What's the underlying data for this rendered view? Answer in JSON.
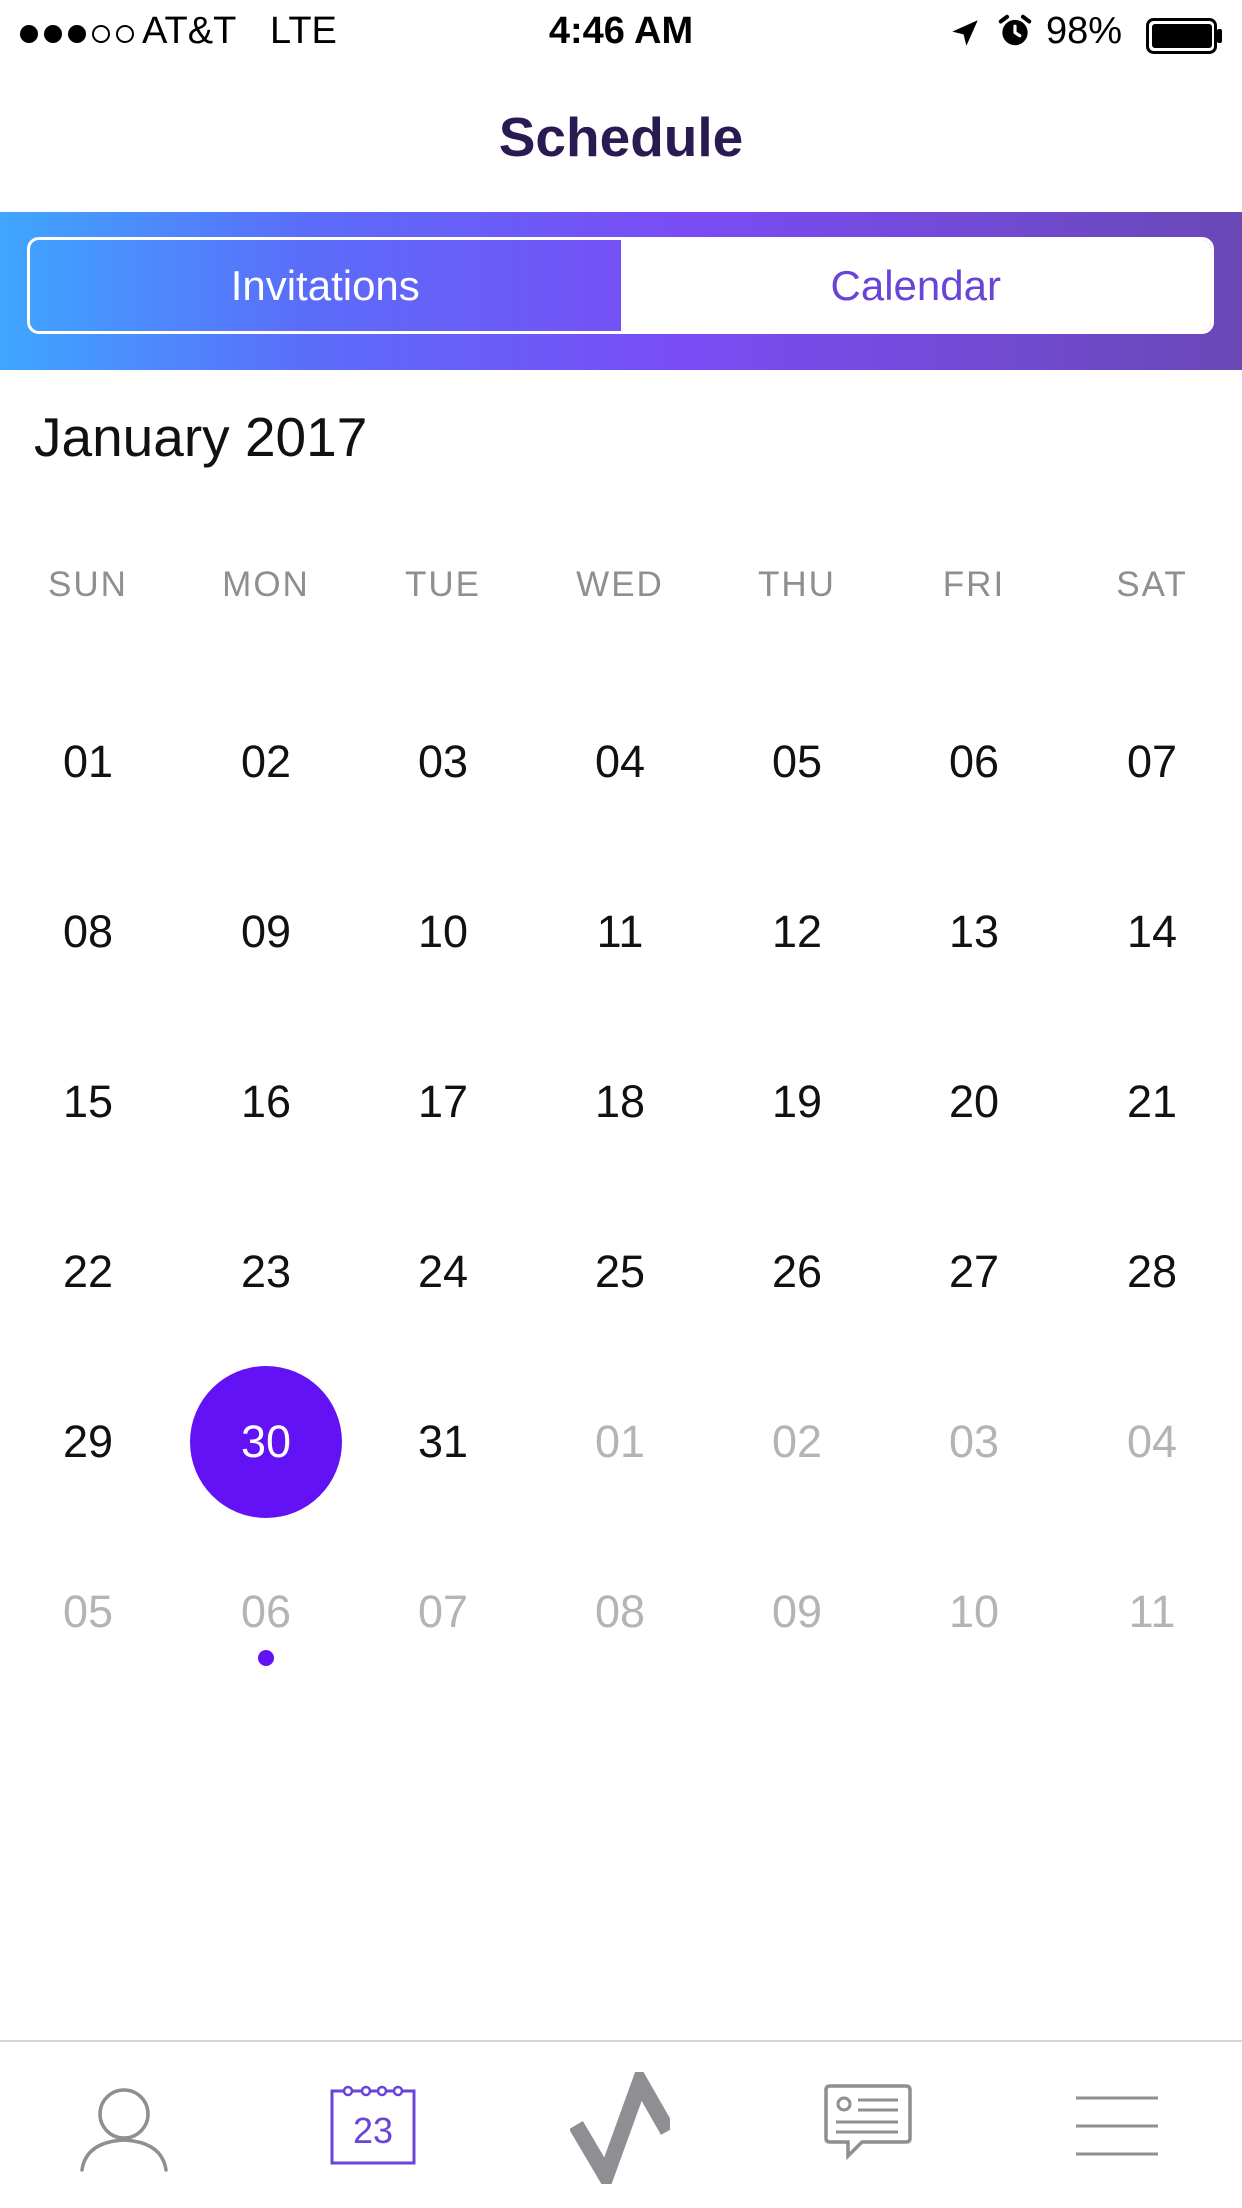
{
  "status_bar": {
    "carrier": "AT&T",
    "network": "LTE",
    "time": "4:46 AM",
    "battery": "98%",
    "signal_bars": 3,
    "signal_total": 5,
    "icons": [
      "location-arrow-icon",
      "alarm-clock-icon",
      "battery-icon"
    ]
  },
  "header": {
    "title": "Schedule"
  },
  "segmented_control": {
    "invitations_label": "Invitations",
    "calendar_label": "Calendar",
    "selected": "Calendar"
  },
  "calendar": {
    "month_label": "January 2017",
    "weekdays": [
      "SUN",
      "MON",
      "TUE",
      "WED",
      "THU",
      "FRI",
      "SAT"
    ],
    "weeks": [
      [
        "01",
        "02",
        "03",
        "04",
        "05",
        "06",
        "07"
      ],
      [
        "08",
        "09",
        "10",
        "11",
        "12",
        "13",
        "14"
      ],
      [
        "15",
        "16",
        "17",
        "18",
        "19",
        "20",
        "21"
      ],
      [
        "22",
        "23",
        "24",
        "25",
        "26",
        "27",
        "28"
      ],
      [
        "29",
        "30",
        "31",
        "01",
        "02",
        "03",
        "04"
      ],
      [
        "05",
        "06",
        "07",
        "08",
        "09",
        "10",
        "11"
      ]
    ],
    "selected_day": "30",
    "event_day": "06"
  },
  "tab_bar": {
    "calendar_icon_number": "23",
    "tabs": [
      "profile-icon",
      "calendar-icon",
      "activity-logo-icon",
      "messages-icon",
      "menu-icon"
    ],
    "active_tab": "calendar-icon"
  },
  "colors": {
    "accent": "#6212f5",
    "title": "#2a1a52",
    "segment_text": "#6a44d8",
    "gradient": [
      "#3fa6ff",
      "#7a4cf5",
      "#6a48b6"
    ]
  }
}
